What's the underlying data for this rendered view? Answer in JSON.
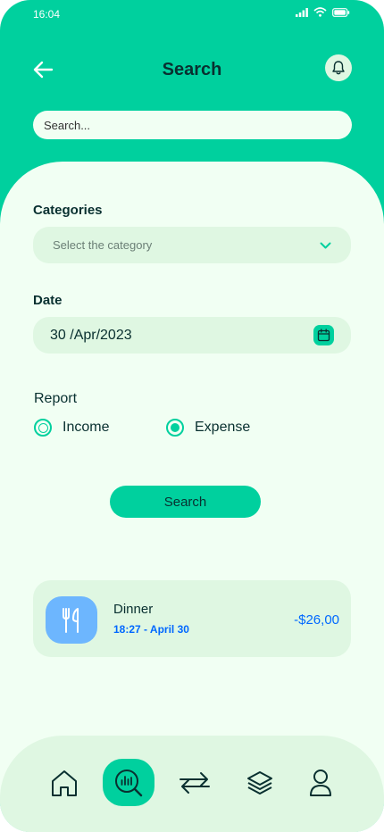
{
  "status_bar": {
    "time": "16:04"
  },
  "header": {
    "title": "Search"
  },
  "search": {
    "placeholder": "Search..."
  },
  "form": {
    "categories_label": "Categories",
    "category_placeholder": "Select the category",
    "date_label": "Date",
    "date_value": "30 /Apr/2023",
    "report_label": "Report",
    "report_options": [
      {
        "label": "Income",
        "selected": false
      },
      {
        "label": "Expense",
        "selected": true
      }
    ],
    "search_button": "Search"
  },
  "result": {
    "icon": "cutlery-icon",
    "title": "Dinner",
    "meta": "18:27 - April 30",
    "amount": "-$26,00"
  },
  "nav": {
    "items": [
      "home-icon",
      "analysis-icon",
      "transfer-icon",
      "layers-icon",
      "profile-icon"
    ],
    "active": "analysis-icon"
  },
  "colors": {
    "primary": "#00D09E",
    "background": "#F1FFF3",
    "field": "#DFF7E2",
    "text": "#093030",
    "accent_blue": "#0068FF",
    "icon_blue": "#6DB6FE"
  }
}
